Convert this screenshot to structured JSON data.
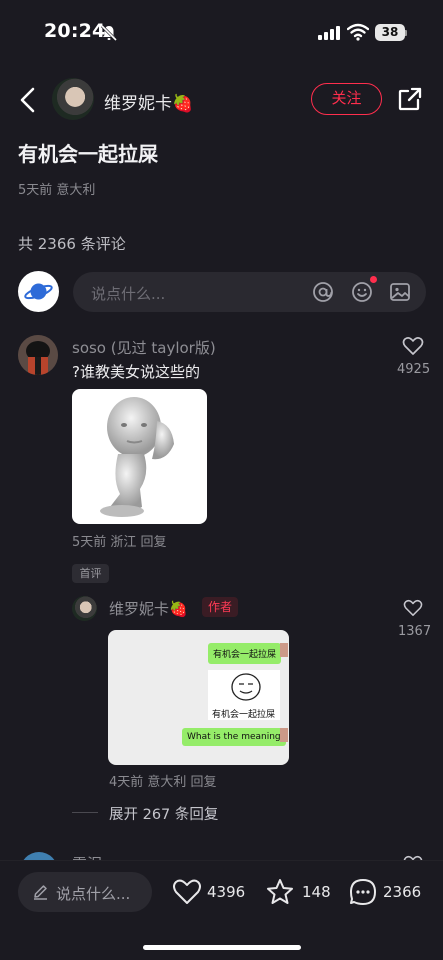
{
  "status_bar": {
    "time": "20:24",
    "battery": "38"
  },
  "header": {
    "author_name": "维罗妮卡🍓",
    "follow_label": "关注"
  },
  "post": {
    "title": "有机会一起拉屎",
    "meta": "5天前 意大利"
  },
  "comments_header": {
    "count_text": "共 2366 条评论"
  },
  "comment_input": {
    "placeholder": "说点什么..."
  },
  "comments": [
    {
      "user": "soso (见过 taylor版)",
      "text": "?谁教美女说这些的",
      "likes": "4925",
      "meta": "5天前 浙江 回复",
      "badge": "首评"
    }
  ],
  "reply": {
    "user": "维罗妮卡🍓",
    "badge": "作者",
    "likes": "1367",
    "chat_bubbles": [
      "有机会一起拉屎",
      "What is the meaning"
    ],
    "meme_caption": "有机会一起拉屎",
    "meta": "4天前 意大利 回复",
    "expand_text": "展开 267 条回复"
  },
  "next_comment": {
    "user": "雷泥"
  },
  "bottom_bar": {
    "placeholder": "说点什么...",
    "likes": "4396",
    "favorites": "148",
    "comments": "2366"
  },
  "colors": {
    "accent": "#ff2e4d",
    "background": "#1b1a21",
    "bubble_green": "#95ec69"
  }
}
